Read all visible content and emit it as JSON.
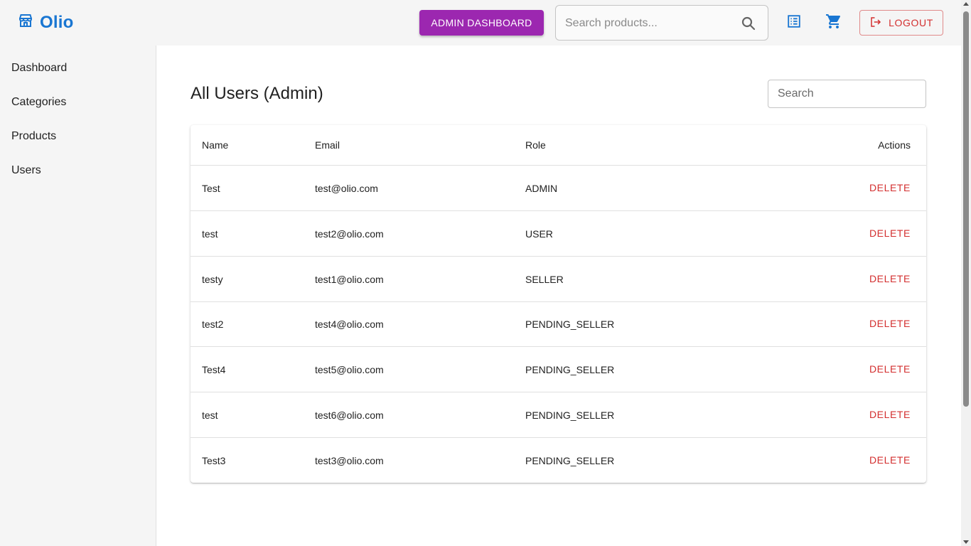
{
  "colors": {
    "brand": "#1976d2",
    "admin_button": "#9c27b0",
    "danger": "#d32f2f"
  },
  "header": {
    "brand": "Olio",
    "brand_icon": "storefront-icon",
    "admin_dashboard_label": "ADMIN DASHBOARD",
    "search_placeholder": "Search products...",
    "orders_icon": "list-alt-icon",
    "cart_icon": "shopping-cart-icon",
    "logout_label": "LOGOUT"
  },
  "sidebar": {
    "items": [
      {
        "label": "Dashboard"
      },
      {
        "label": "Categories"
      },
      {
        "label": "Products"
      },
      {
        "label": "Users"
      }
    ]
  },
  "main": {
    "title": "All Users (Admin)",
    "search_placeholder": "Search",
    "table": {
      "headers": {
        "name": "Name",
        "email": "Email",
        "role": "Role",
        "actions": "Actions"
      },
      "rows": [
        {
          "name": "Test",
          "email": "test@olio.com",
          "role": "ADMIN",
          "action": "DELETE"
        },
        {
          "name": "test",
          "email": "test2@olio.com",
          "role": "USER",
          "action": "DELETE"
        },
        {
          "name": "testy",
          "email": "test1@olio.com",
          "role": "SELLER",
          "action": "DELETE"
        },
        {
          "name": "test2",
          "email": "test4@olio.com",
          "role": "PENDING_SELLER",
          "action": "DELETE"
        },
        {
          "name": "Test4",
          "email": "test5@olio.com",
          "role": "PENDING_SELLER",
          "action": "DELETE"
        },
        {
          "name": "test",
          "email": "test6@olio.com",
          "role": "PENDING_SELLER",
          "action": "DELETE"
        },
        {
          "name": "Test3",
          "email": "test3@olio.com",
          "role": "PENDING_SELLER",
          "action": "DELETE"
        }
      ]
    }
  }
}
